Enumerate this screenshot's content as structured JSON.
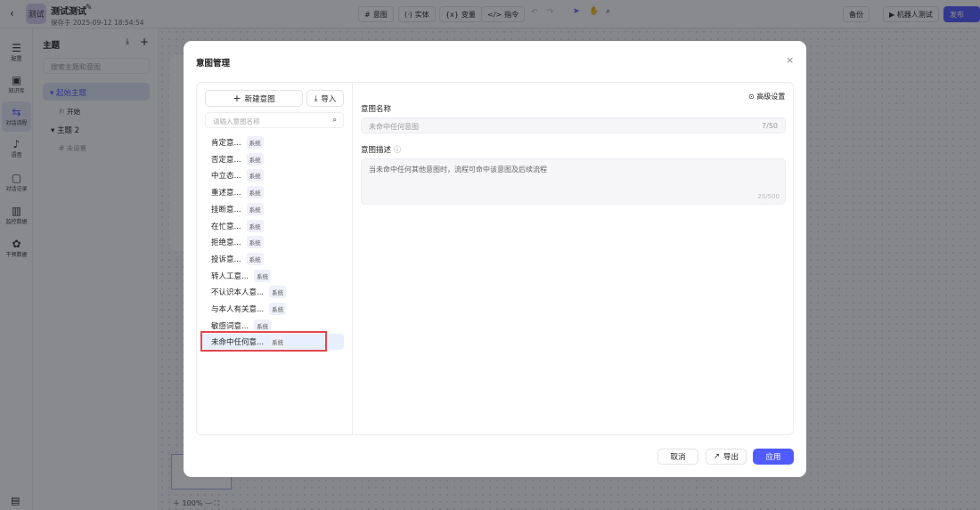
{
  "header": {
    "back_icon": "chevron-left",
    "logo_text": "测试",
    "title": "测试测试",
    "saved": "保存于 2025-09-12 18:54:54",
    "tools": [
      {
        "icon": "#",
        "label": "意图"
      },
      {
        "icon": "(·)",
        "label": "实体"
      },
      {
        "icon": "{x}",
        "label": "变量"
      },
      {
        "icon": "</>",
        "label": "指令"
      }
    ],
    "backup": "备份",
    "robot_test": "▶ 机器人测试",
    "publish": "发布"
  },
  "rail": [
    {
      "icon": "☰",
      "label": "配置"
    },
    {
      "icon": "▣",
      "label": "知识库"
    },
    {
      "icon": "⇆",
      "label": "对话流程"
    },
    {
      "icon": "♪",
      "label": "语音"
    },
    {
      "icon": "▢",
      "label": "对话记录"
    },
    {
      "icon": "▥",
      "label": "监控数据"
    },
    {
      "icon": "✿",
      "label": "干预数据"
    }
  ],
  "topics": {
    "title": "主题",
    "search_placeholder": "搜索主题和意图",
    "items": [
      {
        "label": "起始主题",
        "child": "开始"
      },
      {
        "label": "主题 2",
        "child": "未设置"
      }
    ]
  },
  "zoom": {
    "level": "100%"
  },
  "modal": {
    "title": "意图管理",
    "new_intent": "新建意图",
    "import": "导入",
    "search_placeholder": "请输入意图名称",
    "intents": [
      {
        "name": "肯定意...",
        "tag": "系统"
      },
      {
        "name": "否定意...",
        "tag": "系统"
      },
      {
        "name": "中立态...",
        "tag": "系统"
      },
      {
        "name": "重述意...",
        "tag": "系统"
      },
      {
        "name": "挂断意...",
        "tag": "系统"
      },
      {
        "name": "在忙意...",
        "tag": "系统"
      },
      {
        "name": "拒绝意...",
        "tag": "系统"
      },
      {
        "name": "投诉意...",
        "tag": "系统"
      },
      {
        "name": "转人工意...",
        "tag": "系统"
      },
      {
        "name": "不认识本人意...",
        "tag": "系统"
      },
      {
        "name": "与本人有关意...",
        "tag": "系统"
      },
      {
        "name": "敏感词意...",
        "tag": "系统"
      },
      {
        "name": "未命中任何意...",
        "tag": "系统"
      }
    ],
    "selected_index": 12,
    "advanced": "高级设置",
    "name_label": "意图名称",
    "name_value": "未命中任何意图",
    "name_count": "7/50",
    "desc_label": "意图描述",
    "desc_value": "当未命中任何其他意图时，流程可命中该意图及后续流程",
    "desc_count": "25/500",
    "cancel": "取消",
    "export": "导出",
    "apply": "应用"
  },
  "colors": {
    "primary": "#4f5bff",
    "highlight": "#e8f0ff",
    "annotation": "#e5484d"
  }
}
